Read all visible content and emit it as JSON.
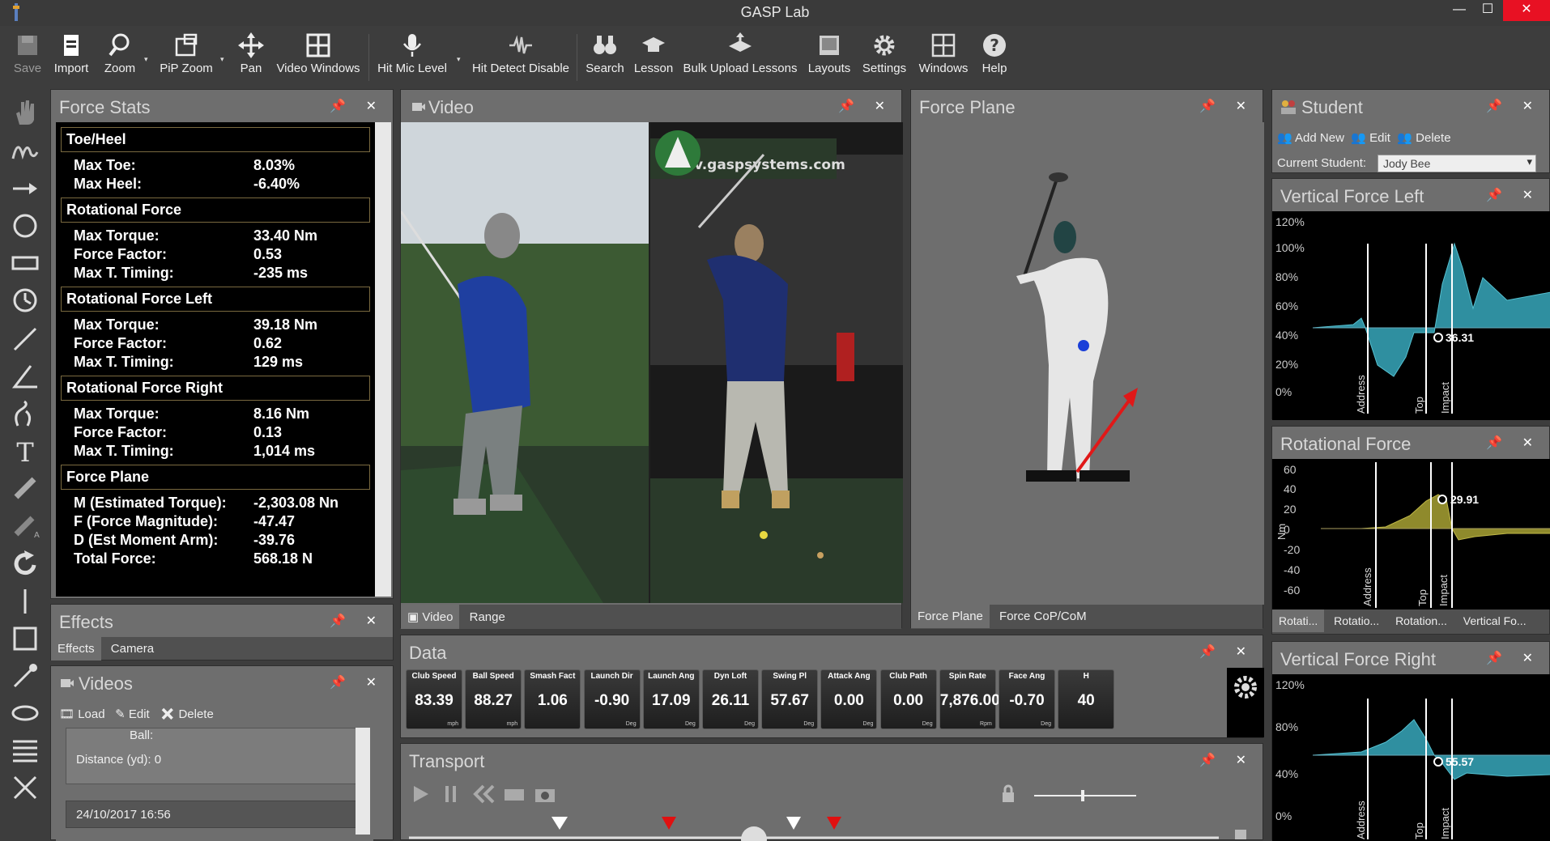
{
  "app": {
    "title": "GASP Lab"
  },
  "window": {
    "min": "—",
    "max": "☐",
    "close": "✕"
  },
  "toolbar": [
    {
      "label": "Save",
      "disabled": true
    },
    {
      "label": "Import"
    },
    {
      "label": "Zoom"
    },
    {
      "label": "PiP Zoom"
    },
    {
      "label": "Pan"
    },
    {
      "label": "Video Windows"
    },
    {
      "label": "Hit Mic Level"
    },
    {
      "label": "Hit Detect Disable"
    },
    {
      "label": "Search"
    },
    {
      "label": "Lesson"
    },
    {
      "label": "Bulk Upload Lessons"
    },
    {
      "label": "Layouts"
    },
    {
      "label": "Settings"
    },
    {
      "label": "Windows"
    },
    {
      "label": "Help"
    }
  ],
  "force_stats": {
    "title": "Force Stats",
    "sections": [
      {
        "header": "Toe/Heel",
        "rows": [
          {
            "k": "Max Toe:",
            "v": "8.03%"
          },
          {
            "k": "Max Heel:",
            "v": "-6.40%"
          }
        ]
      },
      {
        "header": "Rotational Force",
        "rows": [
          {
            "k": "Max Torque:",
            "v": "33.40 Nm"
          },
          {
            "k": "Force Factor:",
            "v": "0.53"
          },
          {
            "k": "Max T. Timing:",
            "v": "-235 ms"
          }
        ]
      },
      {
        "header": "Rotational Force Left",
        "rows": [
          {
            "k": "Max Torque:",
            "v": "39.18 Nm"
          },
          {
            "k": "Force Factor:",
            "v": "0.62"
          },
          {
            "k": "Max T. Timing:",
            "v": "129 ms"
          }
        ]
      },
      {
        "header": "Rotational Force Right",
        "rows": [
          {
            "k": "Max Torque:",
            "v": "8.16 Nm"
          },
          {
            "k": "Force Factor:",
            "v": "0.13"
          },
          {
            "k": "Max T. Timing:",
            "v": "1,014 ms"
          }
        ]
      },
      {
        "header": "Force Plane",
        "rows": [
          {
            "k": "M (Estimated Torque):",
            "v": "-2,303.08 Nn",
            "star": "★"
          },
          {
            "k": "F (Force Magnitude):",
            "v": "-47.47",
            "star": "★"
          },
          {
            "k": "D (Est Moment Arm):",
            "v": "-39.76",
            "star": "★"
          },
          {
            "k": "Total Force:",
            "v": "568.18 N",
            "star": "★"
          }
        ]
      }
    ]
  },
  "effects": {
    "title": "Effects",
    "tabs": [
      "Effects",
      "Camera"
    ]
  },
  "videos": {
    "title": "Videos",
    "actions": [
      "Load",
      "Edit",
      "Delete"
    ],
    "item1": {
      "ball": "Ball:",
      "distance": "Distance (yd): 0"
    },
    "item2": {
      "date": "24/10/2017 16:56"
    }
  },
  "video": {
    "title": "Video",
    "tabs": [
      "Video",
      "Range"
    ],
    "watermark": "v.gaspsystems.com"
  },
  "force_plane": {
    "title": "Force Plane",
    "tabs": [
      "Force Plane",
      "Force CoP/CoM"
    ]
  },
  "student": {
    "title": "Student",
    "actions": [
      "Add New",
      "Edit",
      "Delete"
    ],
    "current_label": "Current Student:",
    "current_value": "Jody Bee"
  },
  "charts": {
    "vfl": {
      "title": "Vertical Force Left",
      "y_ticks": [
        "120%",
        "100%",
        "80%",
        "60%",
        "40%",
        "20%",
        "0%"
      ],
      "markers": [
        "Address",
        "Top",
        "Impact"
      ],
      "value_label": "36.31",
      "color": "#2f8fa0"
    },
    "rot": {
      "title": "Rotational Force",
      "y_ticks": [
        "60",
        "40",
        "20",
        "0",
        "-20",
        "-40",
        "-60"
      ],
      "y_unit": "Nm",
      "markers": [
        "Address",
        "Top",
        "Impact"
      ],
      "value_label": "29.91",
      "color": "#8f8a2c",
      "tabs": [
        "Rotati...",
        "Rotatio...",
        "Rotation...",
        "Vertical Fo..."
      ]
    },
    "vfr": {
      "title": "Vertical Force Right",
      "y_ticks": [
        "120%",
        "80%",
        "40%",
        "0%"
      ],
      "markers": [
        "Address",
        "Top",
        "Impact"
      ],
      "value_label": "55.57",
      "color": "#2f8fa0"
    }
  },
  "data": {
    "title": "Data",
    "tiles": [
      {
        "name": "Club Speed",
        "value": "83.39",
        "unit": "mph"
      },
      {
        "name": "Ball Speed",
        "value": "88.27",
        "unit": "mph"
      },
      {
        "name": "Smash Fact",
        "value": "1.06",
        "unit": ""
      },
      {
        "name": "Launch Dir",
        "value": "-0.90",
        "unit": "Deg"
      },
      {
        "name": "Launch Ang",
        "value": "17.09",
        "unit": "Deg"
      },
      {
        "name": "Dyn Loft",
        "value": "26.11",
        "unit": "Deg"
      },
      {
        "name": "Swing Pl",
        "value": "57.67",
        "unit": "Deg"
      },
      {
        "name": "Attack Ang",
        "value": "0.00",
        "unit": "Deg"
      },
      {
        "name": "Club Path",
        "value": "0.00",
        "unit": "Deg"
      },
      {
        "name": "Spin Rate",
        "value": "7,876.00",
        "unit": "Rpm"
      },
      {
        "name": "Face Ang",
        "value": "-0.70",
        "unit": "Deg"
      },
      {
        "name": "H",
        "value": "40",
        "unit": ""
      }
    ]
  },
  "transport": {
    "title": "Transport"
  },
  "panel_btns": "📌 ✕"
}
